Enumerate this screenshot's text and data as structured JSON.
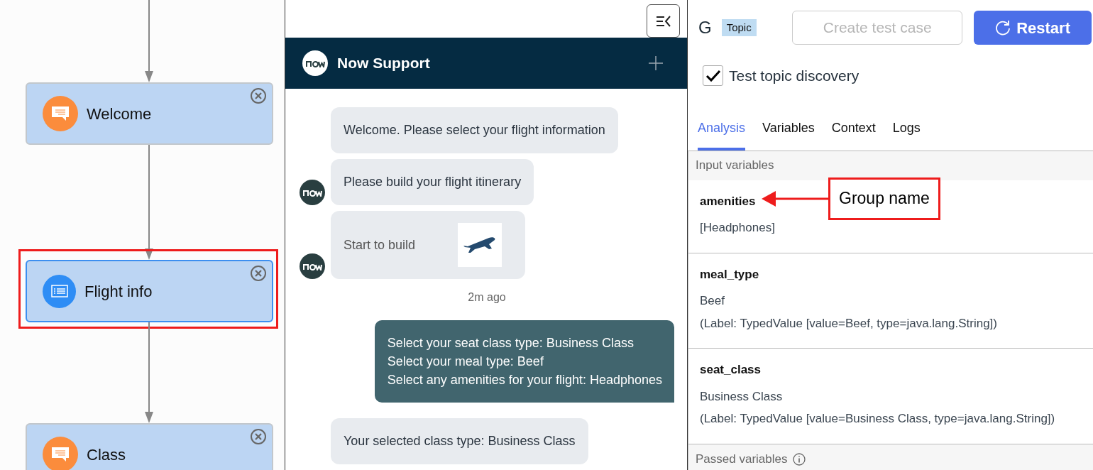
{
  "flow": {
    "nodes": [
      {
        "label": "Welcome",
        "kind": "message",
        "selected": false,
        "highlighted": false
      },
      {
        "label": "Flight info",
        "kind": "form",
        "selected": true,
        "highlighted": true
      },
      {
        "label": "Class",
        "kind": "message",
        "selected": false,
        "highlighted": false
      }
    ]
  },
  "chat": {
    "title": "Now Support",
    "messages": [
      {
        "kind": "bot",
        "text": "Welcome. Please select your flight information",
        "avatar": false
      },
      {
        "kind": "bot",
        "text": "Please build your flight itinerary",
        "avatar": true
      },
      {
        "kind": "card",
        "text": "Start to build",
        "avatar": true
      },
      {
        "kind": "timestamp",
        "text": "2m ago"
      },
      {
        "kind": "user",
        "lines": [
          "Select your seat class type: Business Class",
          "Select your meal type: Beef",
          "Select any amenities for your flight: Headphones"
        ]
      },
      {
        "kind": "bot",
        "text": "Your selected class type: Business Class",
        "avatar": false
      }
    ]
  },
  "panel": {
    "letter": "G",
    "badge": "Topic",
    "buttons": [
      {
        "label": "Create test case",
        "kind": "outline",
        "disabled": true
      },
      {
        "label": "Restart",
        "kind": "primary",
        "disabled": false
      }
    ],
    "checkbox": {
      "label": "Test topic discovery",
      "checked": true
    },
    "tabs": [
      {
        "label": "Analysis",
        "selected": true
      },
      {
        "label": "Variables",
        "selected": false
      },
      {
        "label": "Context",
        "selected": false
      },
      {
        "label": "Logs",
        "selected": false
      }
    ],
    "input_section": "Input variables",
    "variables": [
      {
        "name": "amenities",
        "value": "[Headphones]"
      },
      {
        "name": "meal_type",
        "value": "Beef",
        "detail": "(Label: TypedValue [value=Beef, type=java.lang.String])"
      },
      {
        "name": "seat_class",
        "value": "Business Class",
        "detail": "(Label: TypedValue [value=Business Class, type=java.lang.String])"
      }
    ],
    "passed_section": "Passed variables",
    "annotation": {
      "text": "Group name"
    }
  }
}
